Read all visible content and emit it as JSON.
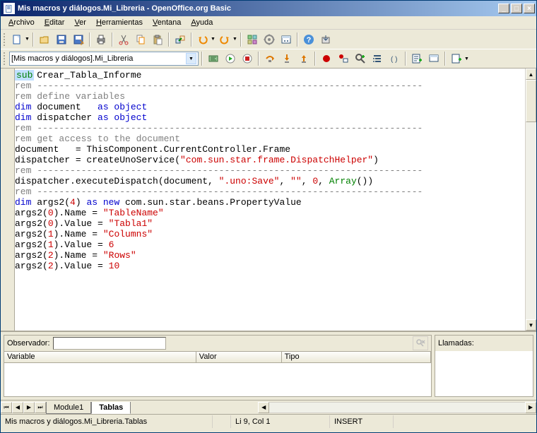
{
  "window": {
    "title": "Mis macros y diálogos.Mi_Libreria - OpenOffice.org Basic"
  },
  "menubar": [
    "Archivo",
    "Editar",
    "Ver",
    "Herramientas",
    "Ventana",
    "Ayuda"
  ],
  "toolbar2": {
    "library_combo": "[Mis macros y diálogos].Mi_Libreria"
  },
  "code": {
    "lines": [
      {
        "t": "sub",
        "segs": [
          {
            "c": "kw-green",
            "t": "sub"
          },
          {
            "c": "",
            "t": " Crear_Tabla_Informe"
          }
        ],
        "hl": true
      },
      {
        "segs": [
          {
            "c": "comment",
            "t": "rem ----------------------------------------------------------------------"
          }
        ]
      },
      {
        "segs": [
          {
            "c": "comment",
            "t": "rem define variables"
          }
        ]
      },
      {
        "segs": [
          {
            "c": "kw-blue",
            "t": "dim"
          },
          {
            "c": "",
            "t": " document   "
          },
          {
            "c": "kw-blue",
            "t": "as object"
          }
        ]
      },
      {
        "segs": [
          {
            "c": "kw-blue",
            "t": "dim"
          },
          {
            "c": "",
            "t": " dispatcher "
          },
          {
            "c": "kw-blue",
            "t": "as object"
          }
        ]
      },
      {
        "segs": [
          {
            "c": "comment",
            "t": "rem ----------------------------------------------------------------------"
          }
        ]
      },
      {
        "segs": [
          {
            "c": "comment",
            "t": "rem get access to the document"
          }
        ]
      },
      {
        "segs": [
          {
            "c": "",
            "t": "document   = ThisComponent.CurrentController.Frame"
          }
        ]
      },
      {
        "segs": [
          {
            "c": "",
            "t": "dispatcher = createUnoService("
          },
          {
            "c": "string",
            "t": "\"com.sun.star.frame.DispatchHelper\""
          },
          {
            "c": "",
            "t": ")"
          }
        ]
      },
      {
        "segs": [
          {
            "c": "",
            "t": ""
          }
        ]
      },
      {
        "segs": [
          {
            "c": "comment",
            "t": "rem ----------------------------------------------------------------------"
          }
        ]
      },
      {
        "segs": [
          {
            "c": "",
            "t": "dispatcher.executeDispatch(document, "
          },
          {
            "c": "string",
            "t": "\".uno:Save\""
          },
          {
            "c": "",
            "t": ", "
          },
          {
            "c": "string",
            "t": "\"\""
          },
          {
            "c": "",
            "t": ", "
          },
          {
            "c": "number",
            "t": "0"
          },
          {
            "c": "",
            "t": ", "
          },
          {
            "c": "kw-green",
            "t": "Array"
          },
          {
            "c": "",
            "t": "())"
          }
        ]
      },
      {
        "segs": [
          {
            "c": "",
            "t": ""
          }
        ]
      },
      {
        "segs": [
          {
            "c": "comment",
            "t": "rem ----------------------------------------------------------------------"
          }
        ]
      },
      {
        "segs": [
          {
            "c": "kw-blue",
            "t": "dim"
          },
          {
            "c": "",
            "t": " args2("
          },
          {
            "c": "number",
            "t": "4"
          },
          {
            "c": "",
            "t": ") "
          },
          {
            "c": "kw-blue",
            "t": "as new"
          },
          {
            "c": "",
            "t": " com.sun.star.beans.PropertyValue"
          }
        ]
      },
      {
        "segs": [
          {
            "c": "",
            "t": "args2("
          },
          {
            "c": "number",
            "t": "0"
          },
          {
            "c": "",
            "t": ").Name = "
          },
          {
            "c": "string",
            "t": "\"TableName\""
          }
        ]
      },
      {
        "segs": [
          {
            "c": "",
            "t": "args2("
          },
          {
            "c": "number",
            "t": "0"
          },
          {
            "c": "",
            "t": ").Value = "
          },
          {
            "c": "string",
            "t": "\"Tabla1\""
          }
        ]
      },
      {
        "segs": [
          {
            "c": "",
            "t": "args2("
          },
          {
            "c": "number",
            "t": "1"
          },
          {
            "c": "",
            "t": ").Name = "
          },
          {
            "c": "string",
            "t": "\"Columns\""
          }
        ]
      },
      {
        "segs": [
          {
            "c": "",
            "t": "args2("
          },
          {
            "c": "number",
            "t": "1"
          },
          {
            "c": "",
            "t": ").Value = "
          },
          {
            "c": "number",
            "t": "6"
          }
        ]
      },
      {
        "segs": [
          {
            "c": "",
            "t": "args2("
          },
          {
            "c": "number",
            "t": "2"
          },
          {
            "c": "",
            "t": ").Name = "
          },
          {
            "c": "string",
            "t": "\"Rows\""
          }
        ]
      },
      {
        "segs": [
          {
            "c": "",
            "t": "args2("
          },
          {
            "c": "number",
            "t": "2"
          },
          {
            "c": "",
            "t": ").Value = "
          },
          {
            "c": "number",
            "t": "10"
          }
        ]
      }
    ]
  },
  "watch": {
    "label": "Observador:",
    "value": "",
    "cols": [
      "Variable",
      "Valor",
      "Tipo"
    ]
  },
  "calls": {
    "label": "Llamadas:"
  },
  "tabs": {
    "items": [
      {
        "label": "Module1",
        "active": false
      },
      {
        "label": "Tablas",
        "active": true
      }
    ]
  },
  "status": {
    "path": "Mis macros y diálogos.Mi_Libreria.Tablas",
    "pos": "Li 9, Col 1",
    "mode": "INSERT"
  }
}
